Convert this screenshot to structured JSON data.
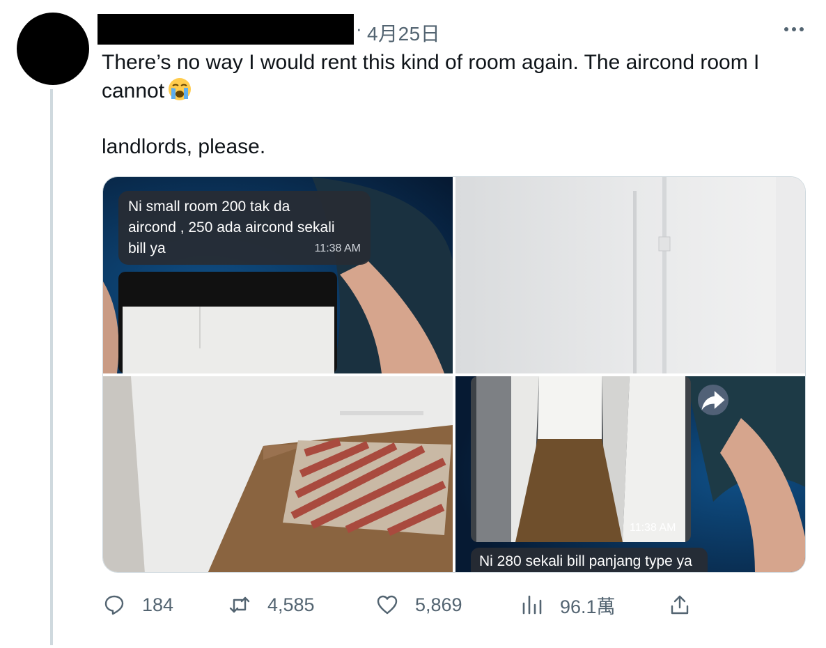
{
  "author": {
    "timestamp": "4月25日",
    "separator": "·"
  },
  "tweet": {
    "lines": [
      "There’s no way I would rent this kind of room again. The aircond room I",
      "cannot",
      "landlords, please."
    ],
    "emoji": "loudly-crying-face"
  },
  "media": {
    "image1": {
      "message": [
        "Ni small room 200 tak da",
        "aircond , 250 ada aircond sekali",
        "bill ya"
      ],
      "time": "11:38 AM"
    },
    "image4": {
      "time": "11:38 AM",
      "caption": "Ni 280 sekali bill panjang type ya"
    }
  },
  "actions": {
    "replies": "184",
    "retweets": "4,585",
    "likes": "5,869",
    "views": "96.1萬"
  },
  "colors": {
    "text": "#0f1419",
    "secondary": "#536471",
    "border": "#cfd9de",
    "thread": "#cfd9de"
  }
}
